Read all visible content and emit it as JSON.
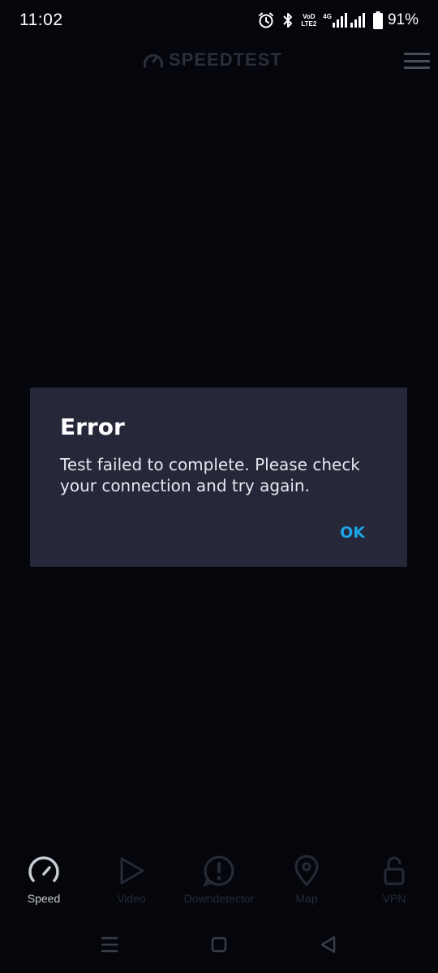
{
  "status_bar": {
    "time": "11:02",
    "carrier_badge_top": "VoD",
    "carrier_badge_bottom": "LTE2",
    "network_type": "4G",
    "battery_percent": "91%"
  },
  "app_bar": {
    "logo_text": "SPEEDTEST"
  },
  "dialog": {
    "title": "Error",
    "message": "Test failed to complete. Please check your connection and try again.",
    "ok_label": "OK"
  },
  "bottom_nav": {
    "items": [
      {
        "label": "Speed",
        "icon": "speedometer-icon",
        "active": true
      },
      {
        "label": "Video",
        "icon": "play-icon",
        "active": false
      },
      {
        "label": "Downdetector",
        "icon": "alert-bubble-icon",
        "active": false
      },
      {
        "label": "Map",
        "icon": "map-pin-icon",
        "active": false
      },
      {
        "label": "VPN",
        "icon": "unlock-icon",
        "active": false
      }
    ]
  },
  "colors": {
    "background": "#05060b",
    "dialog_background": "#26283a",
    "accent": "#1aa6e6",
    "active_nav": "#c9cbd3",
    "inactive_nav": "#262936"
  }
}
